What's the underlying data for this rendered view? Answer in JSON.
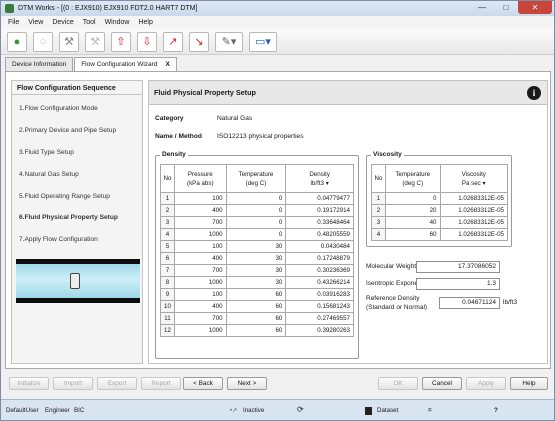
{
  "window": {
    "title": "DTM Works - [(0 : EJX910) EJX910 FDT2.0 HART7 DTM]"
  },
  "menu": [
    "File",
    "View",
    "Device",
    "Tool",
    "Window",
    "Help"
  ],
  "toolbar_icons": [
    "connect-icon",
    "disconnect-icon",
    "tool-icon",
    "tool-disabled-icon",
    "upload-icon",
    "download-icon",
    "arrow-up-icon",
    "arrow-down-icon",
    "wand-icon",
    "monitor-icon"
  ],
  "tabs": [
    {
      "label": "Device Information",
      "active": false
    },
    {
      "label": "Flow Configuration Wizard",
      "active": true,
      "close": "X"
    }
  ],
  "sequence": {
    "title": "Flow Configuration Sequence",
    "items": [
      "1.Flow Configuration Mode",
      "2.Primary Device and Pipe Setup",
      "3.Fluid Type Setup",
      "4.Natural Gas Setup",
      "5.Fluid Operating Range Setup",
      "6.Fluid Physical Property Setup",
      "7.Apply Flow Configuration"
    ],
    "current_index": 5
  },
  "main": {
    "header": "Fluid Physical Property Setup",
    "category_label": "Category",
    "category_value": "Natural Gas",
    "method_label": "Name / Method",
    "method_value": "ISO12213 physical properties"
  },
  "density": {
    "legend": "Density",
    "headers": {
      "no": "No",
      "pressure": "Pressure",
      "pressure_unit": "(kPa abs)",
      "temperature": "Temperature",
      "temperature_unit": "(deg C)",
      "density": "Density",
      "density_unit": "lb/ft3"
    },
    "rows": [
      [
        "1",
        "100",
        "0",
        "0.04779477"
      ],
      [
        "2",
        "400",
        "0",
        "0.19172914"
      ],
      [
        "3",
        "700",
        "0",
        "0.33648464"
      ],
      [
        "4",
        "1000",
        "0",
        "0.48205559"
      ],
      [
        "5",
        "100",
        "30",
        "0.0430484"
      ],
      [
        "6",
        "400",
        "30",
        "0.17248879"
      ],
      [
        "7",
        "700",
        "30",
        "0.30236369"
      ],
      [
        "8",
        "1000",
        "30",
        "0.43266214"
      ],
      [
        "9",
        "100",
        "60",
        "0.03916283"
      ],
      [
        "10",
        "400",
        "60",
        "0.15681243"
      ],
      [
        "11",
        "700",
        "60",
        "0.27469557"
      ],
      [
        "12",
        "1000",
        "60",
        "0.39280263"
      ]
    ]
  },
  "viscosity": {
    "legend": "Viscosity",
    "headers": {
      "no": "No",
      "temperature": "Temperature",
      "temperature_unit": "(deg C)",
      "viscosity": "Viscosity",
      "viscosity_unit": "Pa sec"
    },
    "rows": [
      [
        "1",
        "0",
        "1.02683312E-05"
      ],
      [
        "2",
        "20",
        "1.02683312E-05"
      ],
      [
        "3",
        "40",
        "1.02683312E-05"
      ],
      [
        "4",
        "60",
        "1.02683312E-05"
      ]
    ]
  },
  "properties": {
    "molecular_weight_label": "Molecular Weight",
    "molecular_weight": "17.37086052",
    "isentropic_label": "Isentropic Exponent",
    "isentropic": "1.3",
    "ref_density_label": "Reference Density",
    "ref_density_label2": "(Standard or Normal)",
    "ref_density": "0.04671124",
    "ref_density_unit": "lb/ft3"
  },
  "buttons": {
    "initialize": "Initialize",
    "import": "Import",
    "export": "Export",
    "report": "Report",
    "back": "< Back",
    "next": "Next >",
    "ok": "OK",
    "cancel": "Cancel",
    "apply": "Apply",
    "help": "Help"
  },
  "status": {
    "user": "DefaultUser",
    "role": "Engineer",
    "bic": "BIC",
    "state": "Inactive",
    "dataset": "Dataset"
  }
}
